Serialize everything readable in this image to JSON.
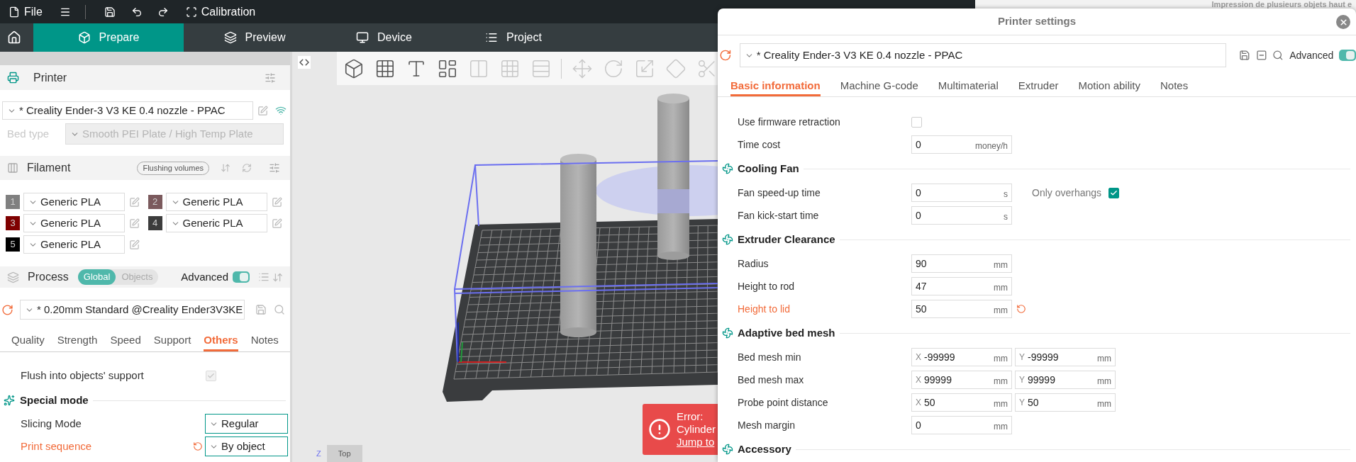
{
  "menu_bar": {
    "file": "File",
    "calibration": "Calibration",
    "background_window_title": "Impression de plusieurs objets haut e"
  },
  "main_tabs": [
    {
      "label": "Prepare",
      "selected": true
    },
    {
      "label": "Preview",
      "selected": false
    },
    {
      "label": "Device",
      "selected": false
    },
    {
      "label": "Project",
      "selected": false
    }
  ],
  "sidebar": {
    "printer": {
      "title": "Printer",
      "preset": "* Creality Ender-3 V3 KE 0.4 nozzle - PPAC",
      "bed_type_label": "Bed type",
      "bed_type": "Smooth PEI Plate / High Temp Plate",
      "bed_type_disabled": true
    },
    "filament": {
      "title": "Filament",
      "flushing_button": "Flushing volumes",
      "slots": [
        {
          "number": "1",
          "name": "Generic PLA",
          "color": "#808080"
        },
        {
          "number": "2",
          "name": "Generic PLA",
          "color": "#7b5a5d"
        },
        {
          "number": "3",
          "name": "Generic PLA",
          "color": "#7f0000"
        },
        {
          "number": "4",
          "name": "Generic PLA",
          "color": "#3c3c3c"
        },
        {
          "number": "5",
          "name": "Generic PLA",
          "color": "#000000"
        }
      ]
    },
    "process": {
      "title": "Process",
      "scope": [
        {
          "label": "Global",
          "selected": true
        },
        {
          "label": "Objects",
          "selected": false
        }
      ],
      "advanced_label": "Advanced",
      "advanced_on": true,
      "preset": "* 0.20mm Standard @Creality Ender3V3KE",
      "tabs": [
        {
          "label": "Quality",
          "selected": false
        },
        {
          "label": "Strength",
          "selected": false
        },
        {
          "label": "Speed",
          "selected": false
        },
        {
          "label": "Support",
          "selected": false
        },
        {
          "label": "Others",
          "selected": true
        },
        {
          "label": "Notes",
          "selected": false
        }
      ],
      "settings": [
        {
          "kind": "checkbox",
          "label": "Flush into objects' support",
          "checked": true,
          "disabled": true
        },
        {
          "kind": "section",
          "title": "Special mode"
        },
        {
          "kind": "combo",
          "label": "Slicing Mode",
          "value": "Regular",
          "modified": false
        },
        {
          "kind": "combo",
          "label": "Print sequence",
          "value": "By object",
          "modified": true
        }
      ]
    }
  },
  "viewport": {
    "error_toast": {
      "title": "Error:",
      "message": "Cylinder",
      "link": "Jump to"
    },
    "view_cube": {
      "axis": "Z",
      "face": "Top"
    }
  },
  "printer_settings": {
    "title": "Printer settings",
    "preset": "* Creality Ender-3 V3 KE 0.4 nozzle - PPAC",
    "advanced_label": "Advanced",
    "advanced_on": true,
    "tabs": [
      {
        "label": "Basic information",
        "selected": true
      },
      {
        "label": "Machine G-code",
        "selected": false
      },
      {
        "label": "Multimaterial",
        "selected": false
      },
      {
        "label": "Extruder",
        "selected": false
      },
      {
        "label": "Motion ability",
        "selected": false
      },
      {
        "label": "Notes",
        "selected": false
      }
    ],
    "settings": [
      {
        "kind": "checkbox",
        "label": "Use firmware retraction",
        "checked": false
      },
      {
        "kind": "field",
        "label": "Time cost",
        "value": "0",
        "unit": "money/h",
        "modified": false
      },
      {
        "kind": "section",
        "title": "Cooling Fan"
      },
      {
        "kind": "field",
        "label": "Fan speed-up time",
        "value": "0",
        "unit": "s",
        "modified": false,
        "extra_check": {
          "label": "Only overhangs",
          "checked": true
        }
      },
      {
        "kind": "field",
        "label": "Fan kick-start time",
        "value": "0",
        "unit": "s",
        "modified": false
      },
      {
        "kind": "section",
        "title": "Extruder Clearance"
      },
      {
        "kind": "field",
        "label": "Radius",
        "value": "90",
        "unit": "mm",
        "modified": false
      },
      {
        "kind": "field",
        "label": "Height to rod",
        "value": "47",
        "unit": "mm",
        "modified": false
      },
      {
        "kind": "field",
        "label": "Height to lid",
        "value": "50",
        "unit": "mm",
        "modified": true
      },
      {
        "kind": "section",
        "title": "Adaptive bed mesh"
      },
      {
        "kind": "xy",
        "label": "Bed mesh min",
        "x": {
          "axis": "X",
          "value": "-99999",
          "unit": "mm"
        },
        "y": {
          "axis": "Y",
          "value": "-99999",
          "unit": "mm"
        }
      },
      {
        "kind": "xy",
        "label": "Bed mesh max",
        "x": {
          "axis": "X",
          "value": "99999",
          "unit": "mm"
        },
        "y": {
          "axis": "Y",
          "value": "99999",
          "unit": "mm"
        }
      },
      {
        "kind": "xy",
        "label": "Probe point distance",
        "x": {
          "axis": "X",
          "value": "50",
          "unit": "mm"
        },
        "y": {
          "axis": "Y",
          "value": "50",
          "unit": "mm"
        }
      },
      {
        "kind": "field",
        "label": "Mesh margin",
        "value": "0",
        "unit": "mm",
        "modified": false
      },
      {
        "kind": "section",
        "title": "Accessory"
      }
    ]
  }
}
